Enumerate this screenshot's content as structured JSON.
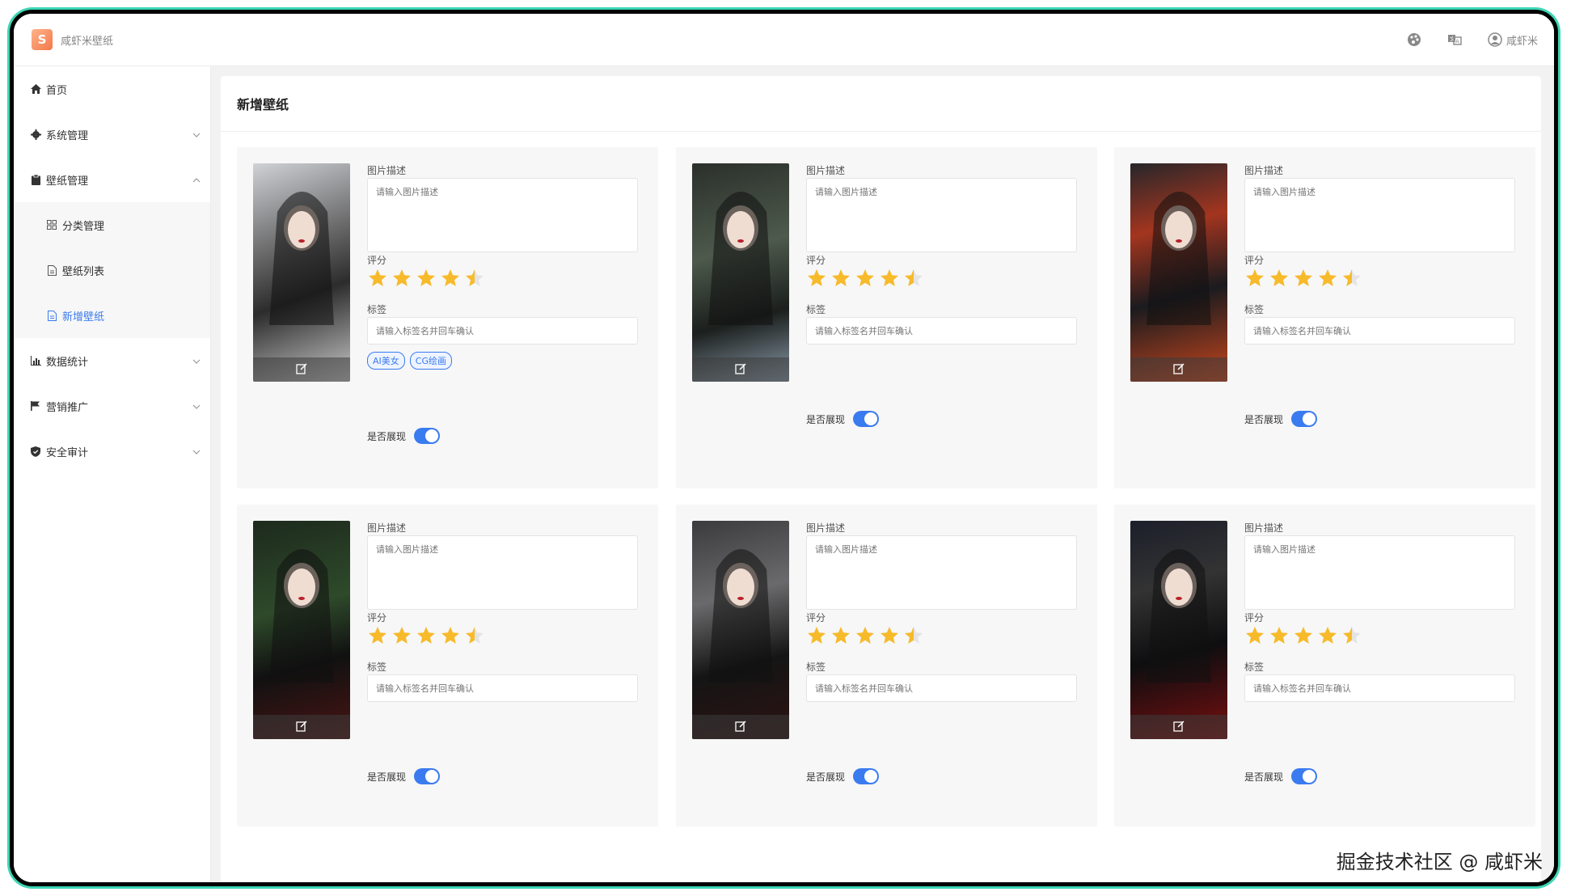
{
  "app": {
    "title": "咸虾米壁纸",
    "logo_glyph": "S",
    "user_name": "咸虾米"
  },
  "header_icons": [
    "palette-icon",
    "translate-icon",
    "user-avatar-icon"
  ],
  "sidebar": {
    "items": [
      {
        "label": "首页",
        "icon": "home-icon"
      },
      {
        "label": "系统管理",
        "icon": "gear-icon"
      },
      {
        "label": "壁纸管理",
        "icon": "clipboard-icon"
      },
      {
        "label": "分类管理",
        "icon": "grid-icon"
      },
      {
        "label": "壁纸列表",
        "icon": "document-icon"
      },
      {
        "label": "新增壁纸",
        "icon": "document-icon"
      },
      {
        "label": "数据统计",
        "icon": "bar-chart-icon"
      },
      {
        "label": "营销推广",
        "icon": "flag-icon"
      },
      {
        "label": "安全审计",
        "icon": "shield-icon"
      }
    ]
  },
  "page": {
    "title": "新增壁纸"
  },
  "labels": {
    "desc": "图片描述",
    "desc_placeholder": "请输入图片描述",
    "rating": "评分",
    "tags": "标签",
    "tags_placeholder": "请输入标签名并回车确认",
    "show": "是否展现"
  },
  "cards": [
    {
      "rating": 4.5,
      "tags": [
        "AI美女",
        "CG绘画"
      ],
      "show": true
    },
    {
      "rating": 4.5,
      "tags": [],
      "show": true
    },
    {
      "rating": 4.5,
      "tags": [],
      "show": true
    },
    {
      "rating": 4.5,
      "tags": [],
      "show": true
    },
    {
      "rating": 4.5,
      "tags": [],
      "show": true
    },
    {
      "rating": 4.5,
      "tags": [],
      "show": true
    }
  ],
  "colors": {
    "accent": "#3a7bf0",
    "star": "#f7ba2a"
  },
  "watermark": "掘金技术社区 @ 咸虾米"
}
